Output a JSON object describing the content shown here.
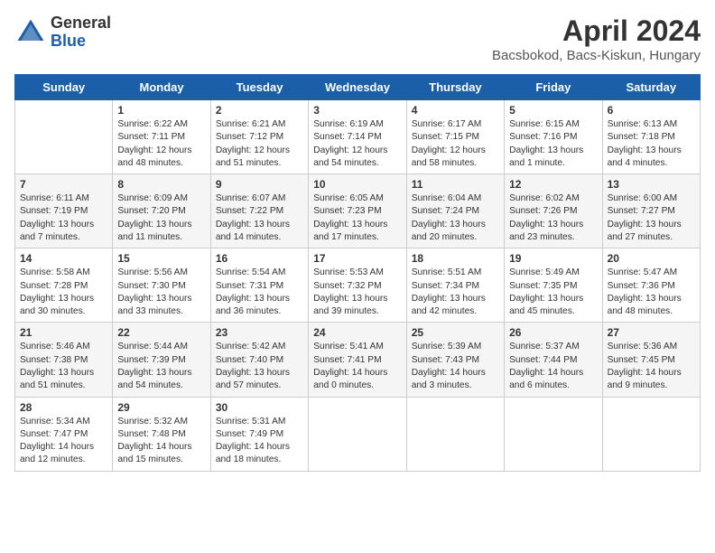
{
  "header": {
    "logo_general": "General",
    "logo_blue": "Blue",
    "title": "April 2024",
    "subtitle": "Bacsbokod, Bacs-Kiskun, Hungary"
  },
  "days": [
    "Sunday",
    "Monday",
    "Tuesday",
    "Wednesday",
    "Thursday",
    "Friday",
    "Saturday"
  ],
  "weeks": [
    [
      {
        "day": "",
        "content": ""
      },
      {
        "day": "1",
        "content": "Sunrise: 6:22 AM\nSunset: 7:11 PM\nDaylight: 12 hours\nand 48 minutes."
      },
      {
        "day": "2",
        "content": "Sunrise: 6:21 AM\nSunset: 7:12 PM\nDaylight: 12 hours\nand 51 minutes."
      },
      {
        "day": "3",
        "content": "Sunrise: 6:19 AM\nSunset: 7:14 PM\nDaylight: 12 hours\nand 54 minutes."
      },
      {
        "day": "4",
        "content": "Sunrise: 6:17 AM\nSunset: 7:15 PM\nDaylight: 12 hours\nand 58 minutes."
      },
      {
        "day": "5",
        "content": "Sunrise: 6:15 AM\nSunset: 7:16 PM\nDaylight: 13 hours\nand 1 minute."
      },
      {
        "day": "6",
        "content": "Sunrise: 6:13 AM\nSunset: 7:18 PM\nDaylight: 13 hours\nand 4 minutes."
      }
    ],
    [
      {
        "day": "7",
        "content": "Sunrise: 6:11 AM\nSunset: 7:19 PM\nDaylight: 13 hours\nand 7 minutes."
      },
      {
        "day": "8",
        "content": "Sunrise: 6:09 AM\nSunset: 7:20 PM\nDaylight: 13 hours\nand 11 minutes."
      },
      {
        "day": "9",
        "content": "Sunrise: 6:07 AM\nSunset: 7:22 PM\nDaylight: 13 hours\nand 14 minutes."
      },
      {
        "day": "10",
        "content": "Sunrise: 6:05 AM\nSunset: 7:23 PM\nDaylight: 13 hours\nand 17 minutes."
      },
      {
        "day": "11",
        "content": "Sunrise: 6:04 AM\nSunset: 7:24 PM\nDaylight: 13 hours\nand 20 minutes."
      },
      {
        "day": "12",
        "content": "Sunrise: 6:02 AM\nSunset: 7:26 PM\nDaylight: 13 hours\nand 23 minutes."
      },
      {
        "day": "13",
        "content": "Sunrise: 6:00 AM\nSunset: 7:27 PM\nDaylight: 13 hours\nand 27 minutes."
      }
    ],
    [
      {
        "day": "14",
        "content": "Sunrise: 5:58 AM\nSunset: 7:28 PM\nDaylight: 13 hours\nand 30 minutes."
      },
      {
        "day": "15",
        "content": "Sunrise: 5:56 AM\nSunset: 7:30 PM\nDaylight: 13 hours\nand 33 minutes."
      },
      {
        "day": "16",
        "content": "Sunrise: 5:54 AM\nSunset: 7:31 PM\nDaylight: 13 hours\nand 36 minutes."
      },
      {
        "day": "17",
        "content": "Sunrise: 5:53 AM\nSunset: 7:32 PM\nDaylight: 13 hours\nand 39 minutes."
      },
      {
        "day": "18",
        "content": "Sunrise: 5:51 AM\nSunset: 7:34 PM\nDaylight: 13 hours\nand 42 minutes."
      },
      {
        "day": "19",
        "content": "Sunrise: 5:49 AM\nSunset: 7:35 PM\nDaylight: 13 hours\nand 45 minutes."
      },
      {
        "day": "20",
        "content": "Sunrise: 5:47 AM\nSunset: 7:36 PM\nDaylight: 13 hours\nand 48 minutes."
      }
    ],
    [
      {
        "day": "21",
        "content": "Sunrise: 5:46 AM\nSunset: 7:38 PM\nDaylight: 13 hours\nand 51 minutes."
      },
      {
        "day": "22",
        "content": "Sunrise: 5:44 AM\nSunset: 7:39 PM\nDaylight: 13 hours\nand 54 minutes."
      },
      {
        "day": "23",
        "content": "Sunrise: 5:42 AM\nSunset: 7:40 PM\nDaylight: 13 hours\nand 57 minutes."
      },
      {
        "day": "24",
        "content": "Sunrise: 5:41 AM\nSunset: 7:41 PM\nDaylight: 14 hours\nand 0 minutes."
      },
      {
        "day": "25",
        "content": "Sunrise: 5:39 AM\nSunset: 7:43 PM\nDaylight: 14 hours\nand 3 minutes."
      },
      {
        "day": "26",
        "content": "Sunrise: 5:37 AM\nSunset: 7:44 PM\nDaylight: 14 hours\nand 6 minutes."
      },
      {
        "day": "27",
        "content": "Sunrise: 5:36 AM\nSunset: 7:45 PM\nDaylight: 14 hours\nand 9 minutes."
      }
    ],
    [
      {
        "day": "28",
        "content": "Sunrise: 5:34 AM\nSunset: 7:47 PM\nDaylight: 14 hours\nand 12 minutes."
      },
      {
        "day": "29",
        "content": "Sunrise: 5:32 AM\nSunset: 7:48 PM\nDaylight: 14 hours\nand 15 minutes."
      },
      {
        "day": "30",
        "content": "Sunrise: 5:31 AM\nSunset: 7:49 PM\nDaylight: 14 hours\nand 18 minutes."
      },
      {
        "day": "",
        "content": ""
      },
      {
        "day": "",
        "content": ""
      },
      {
        "day": "",
        "content": ""
      },
      {
        "day": "",
        "content": ""
      }
    ]
  ]
}
